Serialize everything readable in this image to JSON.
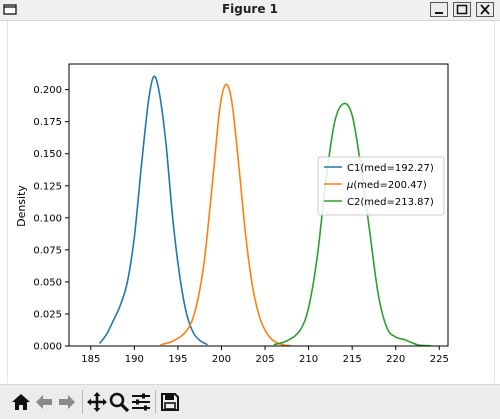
{
  "window": {
    "title": "Figure 1"
  },
  "chart_data": {
    "type": "line",
    "xlabel": "",
    "ylabel": "Density",
    "xlim": [
      182.5,
      226
    ],
    "ylim": [
      0,
      0.22
    ],
    "xticks": [
      "185",
      "190",
      "195",
      "200",
      "205",
      "210",
      "215",
      "220",
      "225"
    ],
    "yticks": [
      "0.000",
      "0.025",
      "0.050",
      "0.075",
      "0.100",
      "0.125",
      "0.150",
      "0.175",
      "0.200"
    ],
    "legend_position": "center-right",
    "series": [
      {
        "name": "C1(med=192.27)",
        "color": "#1f77b4",
        "x": [
          186.0,
          186.8,
          187.6,
          188.4,
          189.2,
          190.0,
          190.8,
          191.6,
          192.2,
          192.8,
          193.6,
          194.4,
          195.2,
          196.0,
          196.8,
          197.6,
          198.4
        ],
        "y": [
          0.002,
          0.009,
          0.02,
          0.032,
          0.05,
          0.085,
          0.14,
          0.19,
          0.21,
          0.2,
          0.16,
          0.1,
          0.055,
          0.025,
          0.01,
          0.004,
          0.001
        ]
      },
      {
        "name": "$\\mu$(med=200.47)",
        "color": "#ff7f0e",
        "x": [
          193.0,
          194.5,
          196.0,
          197.0,
          198.0,
          199.0,
          199.8,
          200.5,
          201.2,
          202.0,
          202.8,
          203.6,
          204.4,
          205.2,
          206.0,
          207.0,
          208.0
        ],
        "y": [
          0.001,
          0.004,
          0.012,
          0.028,
          0.065,
          0.13,
          0.185,
          0.204,
          0.19,
          0.14,
          0.085,
          0.045,
          0.022,
          0.01,
          0.004,
          0.001,
          0.0003
        ]
      },
      {
        "name": "C2(med=213.87)",
        "color": "#2ca02c",
        "x": [
          206.0,
          207.5,
          209.0,
          210.0,
          211.0,
          212.0,
          213.0,
          214.0,
          215.0,
          216.0,
          217.0,
          218.0,
          219.0,
          220.0,
          221.0,
          222.5,
          224.0
        ],
        "y": [
          0.001,
          0.004,
          0.012,
          0.03,
          0.07,
          0.13,
          0.175,
          0.189,
          0.18,
          0.14,
          0.09,
          0.04,
          0.014,
          0.007,
          0.005,
          0.001,
          0.0002
        ]
      }
    ]
  },
  "toolbar": {
    "items": [
      "home-icon",
      "back-icon",
      "forward-icon",
      "pan-icon",
      "zoom-icon",
      "configure-icon",
      "save-icon"
    ]
  }
}
